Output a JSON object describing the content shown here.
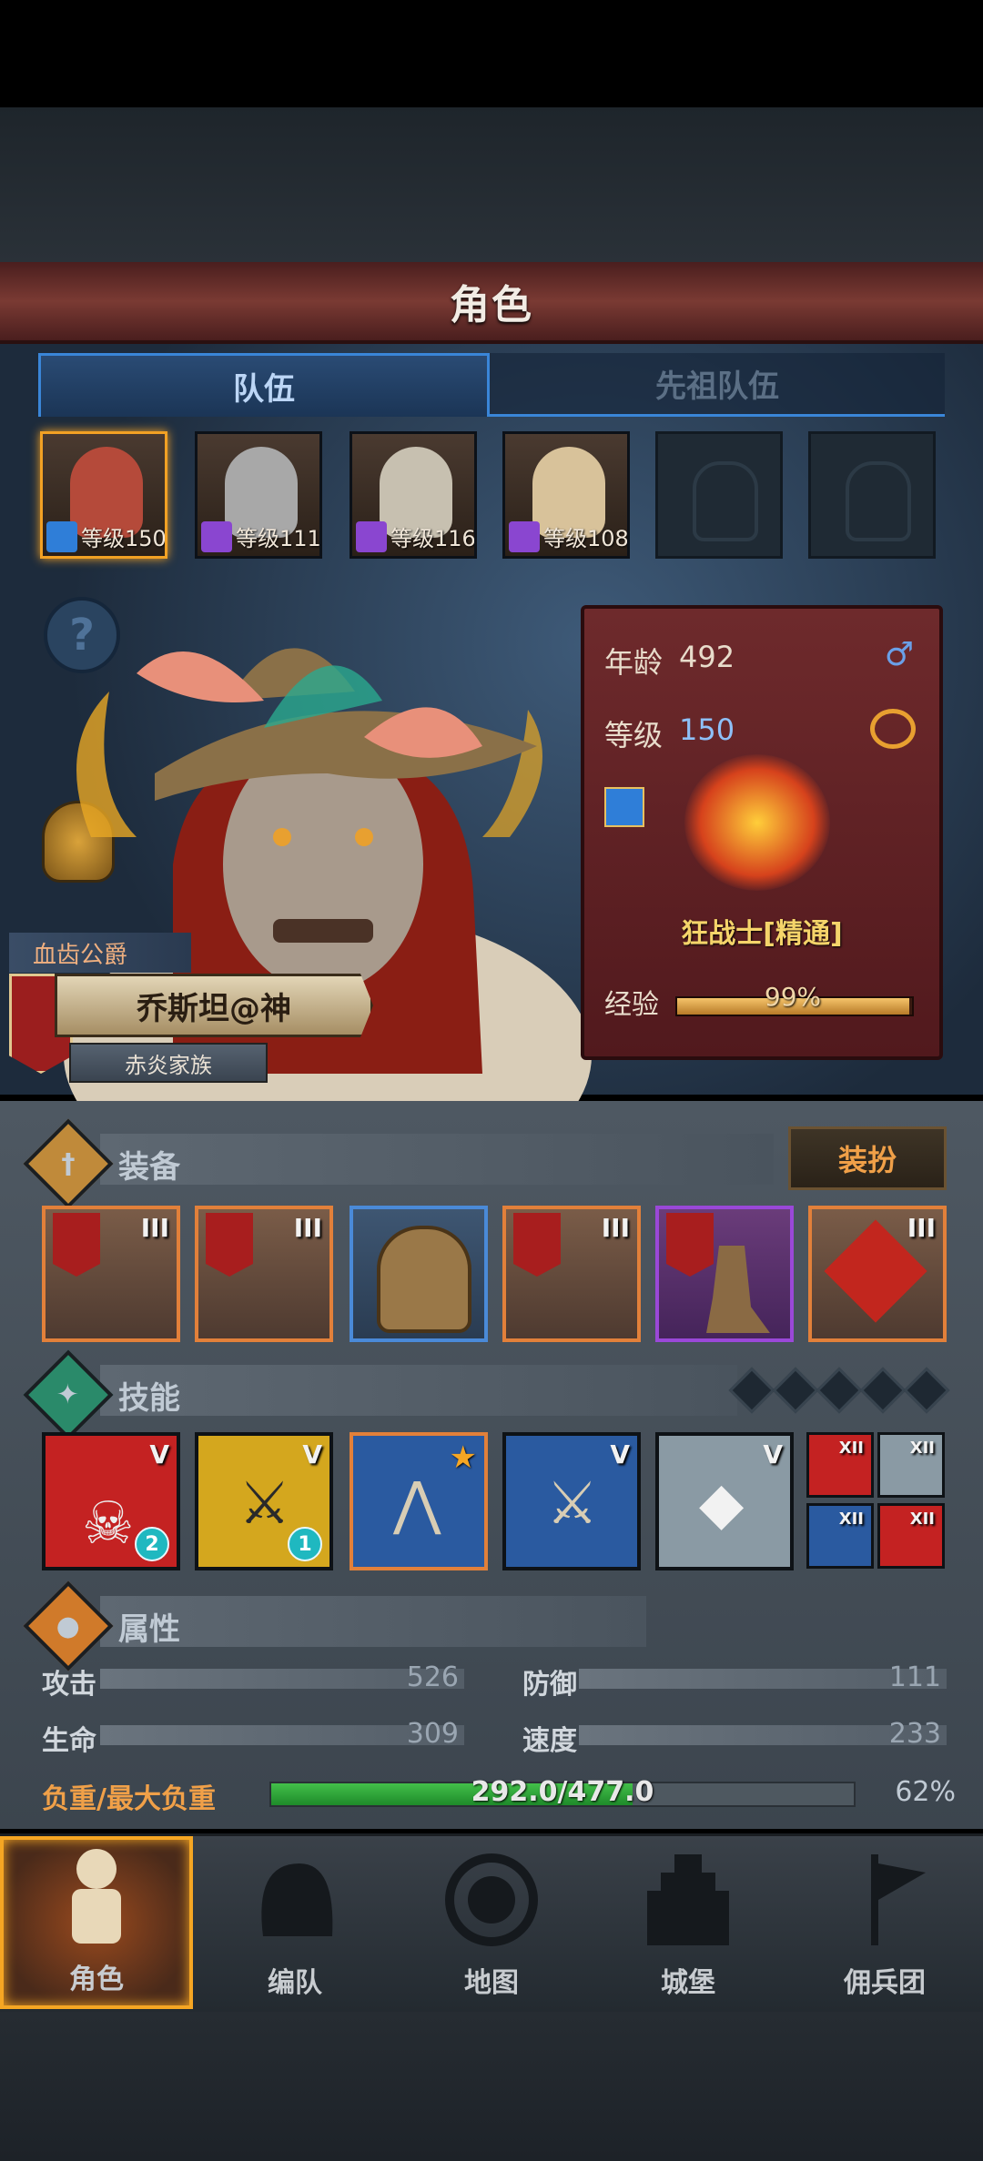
{
  "header": {
    "title": "角色"
  },
  "tabs": [
    {
      "label": "队伍",
      "active": true
    },
    {
      "label": "先祖队伍",
      "active": false
    }
  ],
  "party": [
    {
      "level": "等级150",
      "active": true,
      "gem_color": "#2f7ed8",
      "face": "#b54a3a"
    },
    {
      "level": "等级111",
      "active": false,
      "gem_color": "#8a46d0",
      "face": "#a8a8a8"
    },
    {
      "level": "等级116",
      "active": false,
      "gem_color": "#8a46d0",
      "face": "#c7c0b0"
    },
    {
      "level": "等级108",
      "active": false,
      "gem_color": "#8a46d0",
      "face": "#d8c29a"
    },
    {
      "empty": true
    },
    {
      "empty": true
    }
  ],
  "help": {
    "icon": "?"
  },
  "hero": {
    "title": "血齿公爵",
    "name": "乔斯坦@神",
    "clan": "赤炎家族"
  },
  "info": {
    "age_label": "年龄",
    "age": "492",
    "level_label": "等级",
    "level": "150",
    "class_name": "狂战士[精通]",
    "exp_label": "经验",
    "exp_pct": "99%",
    "exp_value": 0.99,
    "gender_icon": "male-icon",
    "ring_icon": "ring-icon"
  },
  "equipment": {
    "title": "装备",
    "dress_button": "装扮",
    "slots": [
      {
        "item": "axe",
        "tier": "III",
        "rarity": "orange"
      },
      {
        "item": "axe",
        "tier": "III",
        "rarity": "orange"
      },
      {
        "item": "helmet",
        "tier": "",
        "rarity": "blue"
      },
      {
        "item": "armor",
        "tier": "III",
        "rarity": "orange"
      },
      {
        "item": "boots",
        "tier": "",
        "rarity": "purple"
      },
      {
        "item": "amulet",
        "tier": "III",
        "rarity": "orange"
      }
    ]
  },
  "skills": {
    "title": "技能",
    "slots": [
      {
        "color": "#c42222",
        "tier": "V",
        "badge": "2"
      },
      {
        "color": "#d4a71e",
        "tier": "V",
        "badge": "1"
      },
      {
        "color": "#2a5aa0",
        "tier": "",
        "badge": "",
        "starred": true
      },
      {
        "color": "#2a5aa0",
        "tier": "V",
        "badge": ""
      },
      {
        "color": "#8a9aa4",
        "tier": "V",
        "badge": ""
      }
    ],
    "mini": [
      {
        "color": "#c42222",
        "tier": "XII"
      },
      {
        "color": "#8a9aa4",
        "tier": "XII"
      },
      {
        "color": "#2a5aa0",
        "tier": "XII"
      },
      {
        "color": "#c42222",
        "tier": "XII"
      }
    ]
  },
  "attributes": {
    "title": "属性",
    "attack_label": "攻击",
    "attack": "526",
    "defense_label": "防御",
    "defense": "111",
    "hp_label": "生命",
    "hp": "309",
    "speed_label": "速度",
    "speed": "233",
    "load_label": "负重/最大负重",
    "load_text": "292.0/477.0",
    "load_pct": "62%",
    "load_value": 0.62
  },
  "nav": [
    {
      "label": "角色",
      "active": true
    },
    {
      "label": "编队",
      "active": false
    },
    {
      "label": "地图",
      "active": false
    },
    {
      "label": "城堡",
      "active": false
    },
    {
      "label": "佣兵团",
      "active": false
    }
  ],
  "colors": {
    "accent": "#f5a623",
    "tab_blue": "#3a86d8",
    "title_red": "#7a3a33"
  }
}
